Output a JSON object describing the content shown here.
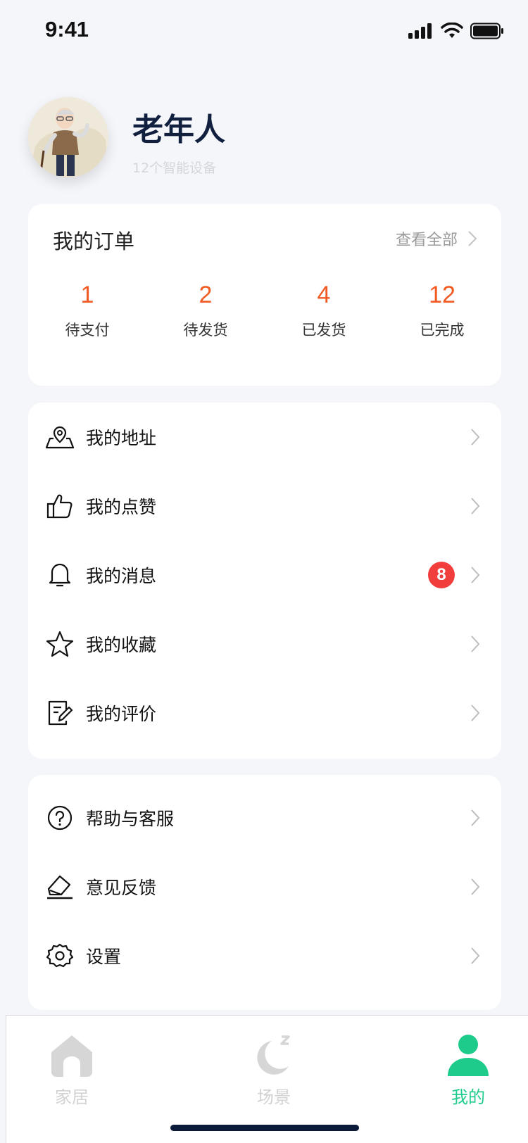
{
  "status_bar": {
    "time": "9:41"
  },
  "profile": {
    "name": "老年人",
    "device_count_text": "12个智能设备"
  },
  "orders": {
    "title": "我的订单",
    "view_all": "查看全部",
    "items": [
      {
        "count": "1",
        "label": "待支付"
      },
      {
        "count": "2",
        "label": "待发货"
      },
      {
        "count": "4",
        "label": "已发货"
      },
      {
        "count": "12",
        "label": "已完成"
      }
    ]
  },
  "menu_main": {
    "items": [
      {
        "label": "我的地址",
        "icon": "location-map-icon"
      },
      {
        "label": "我的点赞",
        "icon": "thumbs-up-icon"
      },
      {
        "label": "我的消息",
        "icon": "bell-icon",
        "badge": "8"
      },
      {
        "label": "我的收藏",
        "icon": "star-icon"
      },
      {
        "label": "我的评价",
        "icon": "edit-note-icon"
      }
    ]
  },
  "menu_support": {
    "items": [
      {
        "label": "帮助与客服",
        "icon": "help-icon"
      },
      {
        "label": "意见反馈",
        "icon": "feedback-icon"
      },
      {
        "label": "设置",
        "icon": "gear-icon"
      }
    ]
  },
  "tab_bar": {
    "tabs": [
      {
        "label": "家居",
        "icon": "home-icon",
        "active": false
      },
      {
        "label": "场景",
        "icon": "moon-icon",
        "active": false
      },
      {
        "label": "我的",
        "icon": "person-icon",
        "active": true
      }
    ]
  },
  "colors": {
    "accent": "#1fcb8b",
    "order_count": "#f15a22",
    "badge": "#f23d3d",
    "title": "#122040"
  }
}
